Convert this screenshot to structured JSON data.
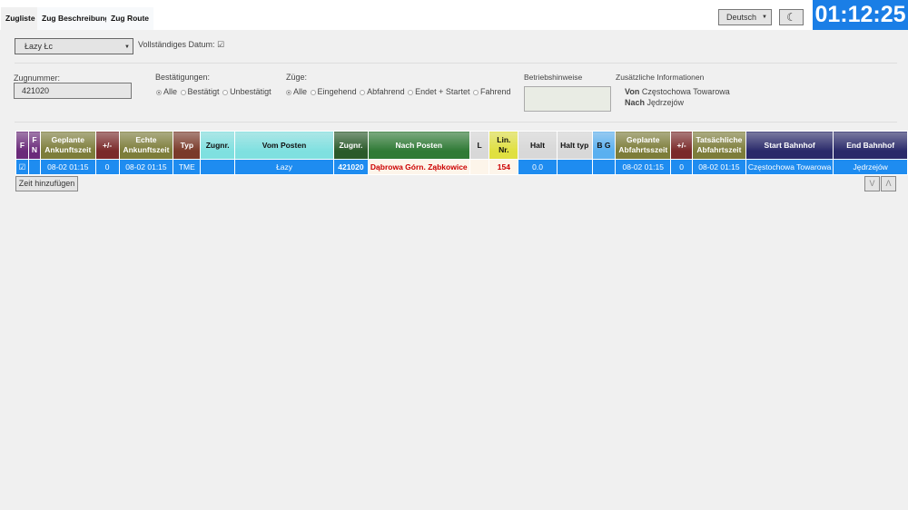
{
  "tabs": [
    {
      "label": "Zugliste",
      "active": true
    },
    {
      "label": "Zug Beschreibung"
    },
    {
      "label": "Zug Route"
    }
  ],
  "header": {
    "language": "Deutsch",
    "theme_icon": "moon-icon",
    "clock": "01:12:25"
  },
  "station_select": "Łazy Łc",
  "full_date_label": "Vollständiges Datum:",
  "full_date_checked": true,
  "filters": {
    "train_number_label": "Zugnummer:",
    "train_number_value": "421020",
    "confirmations_label": "Bestätigungen:",
    "confirmations": [
      "Alle",
      "Bestätigt",
      "Unbestätigt"
    ],
    "confirmations_selected": "Alle",
    "trains_label": "Züge:",
    "trains": [
      "Alle",
      "Eingehend",
      "Abfahrend",
      "Endet + Startet",
      "Fahrend"
    ],
    "trains_selected": "Alle",
    "notes_label": "Betriebshinweise",
    "info_label": "Zusätzliche Informationen",
    "from_label": "Von",
    "from_value": "Częstochowa Towarowa",
    "to_label": "Nach",
    "to_value": "Jędrzejów"
  },
  "table": {
    "columns": [
      {
        "l1": "F",
        "l2": "",
        "color": "#6a2a7a"
      },
      {
        "l1": "F",
        "l2": "N",
        "color": "#6a2a7a"
      },
      {
        "l1": "Geplante",
        "l2": "Ankunftszeit",
        "color": "#7d7d3a"
      },
      {
        "l1": "+/-",
        "l2": "",
        "color": "#7a2a2a"
      },
      {
        "l1": "Echte",
        "l2": "Ankunftszeit",
        "color": "#7d7d3a"
      },
      {
        "l1": "Typ",
        "l2": "",
        "color": "#7a3a2a"
      },
      {
        "l1": "Zugnr.",
        "l2": "",
        "color": "#7fe0e0",
        "dark": true
      },
      {
        "l1": "Vom Posten",
        "l2": "",
        "color": "#7fe0e0",
        "dark": true
      },
      {
        "l1": "Zugnr.",
        "l2": "",
        "color": "#2a5a2a"
      },
      {
        "l1": "Nach Posten",
        "l2": "",
        "color": "#2f7a35"
      },
      {
        "l1": "L",
        "l2": "",
        "color": "#d8d8d8",
        "dark": true
      },
      {
        "l1": "Lin.",
        "l2": "Nr.",
        "color": "#e0e040",
        "dark": true
      },
      {
        "l1": "Halt",
        "l2": "",
        "color": "#d8d8d8",
        "dark": true
      },
      {
        "l1": "Halt typ",
        "l2": "",
        "color": "#d8d8d8",
        "dark": true
      },
      {
        "l1": "B G",
        "l2": "",
        "color": "#5ab0f0",
        "dark": true
      },
      {
        "l1": "Geplante",
        "l2": "Abfahrtsszeit",
        "color": "#7d7d3a"
      },
      {
        "l1": "+/-",
        "l2": "",
        "color": "#7a2a2a"
      },
      {
        "l1": "Tatsächliche",
        "l2": "Abfahrtszeit",
        "color": "#7d7d3a"
      },
      {
        "l1": "Start Bahnhof",
        "l2": "",
        "color": "#2a2a6a"
      },
      {
        "l1": "End Bahnhof",
        "l2": "",
        "color": "#2a2a6a"
      }
    ],
    "rows": [
      [
        "☑",
        "",
        "08-02 01:15",
        "0",
        "08-02 01:15",
        "TME",
        "",
        "Łazy",
        "421020",
        "Dąbrowa Górn. Ząbkowice",
        "",
        "154",
        "0.0",
        "",
        "",
        "08-02 01:15",
        "0",
        "08-02 01:15",
        "Częstochowa Towarowa",
        "Jędrzejów"
      ]
    ]
  },
  "add_time_button": "Zeit hinzufügen",
  "scroll_down": "V",
  "scroll_up": "Λ"
}
